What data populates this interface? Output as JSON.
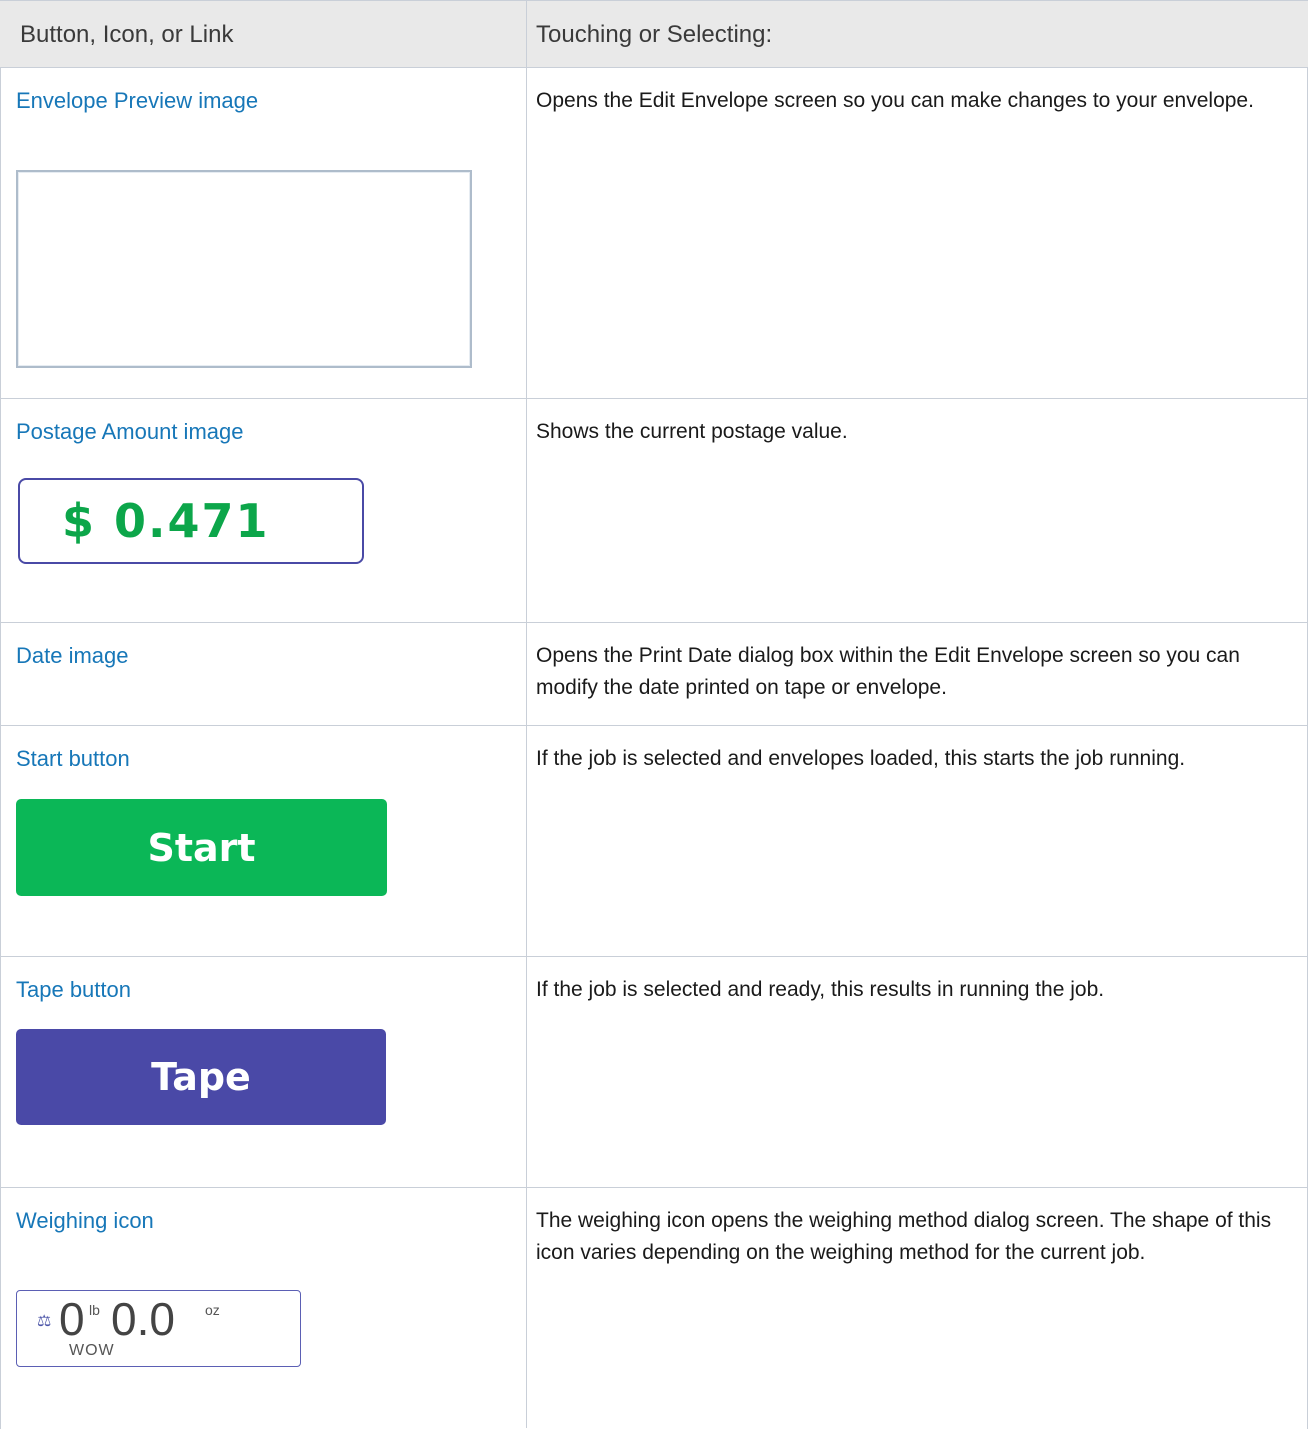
{
  "table": {
    "header": {
      "col1": "Button, Icon, or Link",
      "col2": "Touching or Selecting:"
    },
    "rows": [
      {
        "label": "Envelope Preview image",
        "description": "Opens the Edit Envelope screen so you can make changes to your envelope."
      },
      {
        "label": "Postage Amount image",
        "description": "Shows the current postage value.",
        "postage_value": "$ 0.471"
      },
      {
        "label": "Date image",
        "description": "Opens the Print Date dialog box within the Edit Envelope screen so you can modify the date printed on tape or envelope."
      },
      {
        "label": "Start button",
        "description": "If the job is selected and envelopes loaded, this starts the job running.",
        "button_text": "Start"
      },
      {
        "label": "Tape button",
        "description": "If the job is selected and ready, this results in running the job.",
        "button_text": "Tape"
      },
      {
        "label": "Weighing icon",
        "description": "The weighing icon opens the weighing method dialog screen. The shape of this icon varies depending on the weighing method for the current job.",
        "weight_lb": "0",
        "lb_unit": "lb",
        "weight_oz": "0.0",
        "oz_unit": "oz",
        "method": "WOW"
      }
    ]
  },
  "colors": {
    "link": "#1777b8",
    "start_green": "#0bb757",
    "tape_purple": "#4a49a7",
    "postage_green": "#0ca64a"
  }
}
